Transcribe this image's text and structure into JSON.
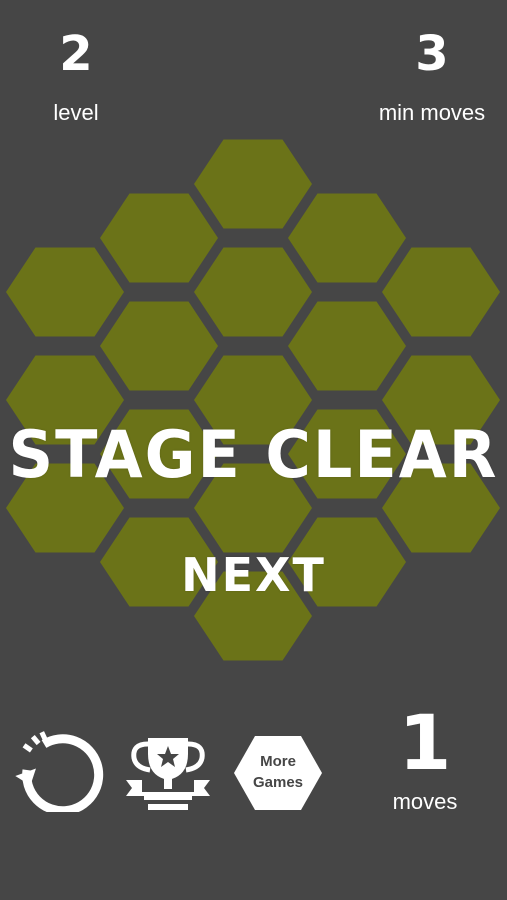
{
  "hud": {
    "level_value": "2",
    "level_label": "level",
    "min_moves_value": "3",
    "min_moves_label": "min moves",
    "moves_value": "1",
    "moves_label": "moves"
  },
  "overlay": {
    "stage_clear": "STAGE CLEAR",
    "next": "NEXT"
  },
  "toolbar": {
    "more_games_line1": "More",
    "more_games_line2": "Games",
    "restart_icon": "restart-icon",
    "trophy_icon": "trophy-icon"
  },
  "colors": {
    "background": "#464646",
    "tile": "#6b7318",
    "text": "#ffffff"
  },
  "board": {
    "tile_count": 19
  }
}
